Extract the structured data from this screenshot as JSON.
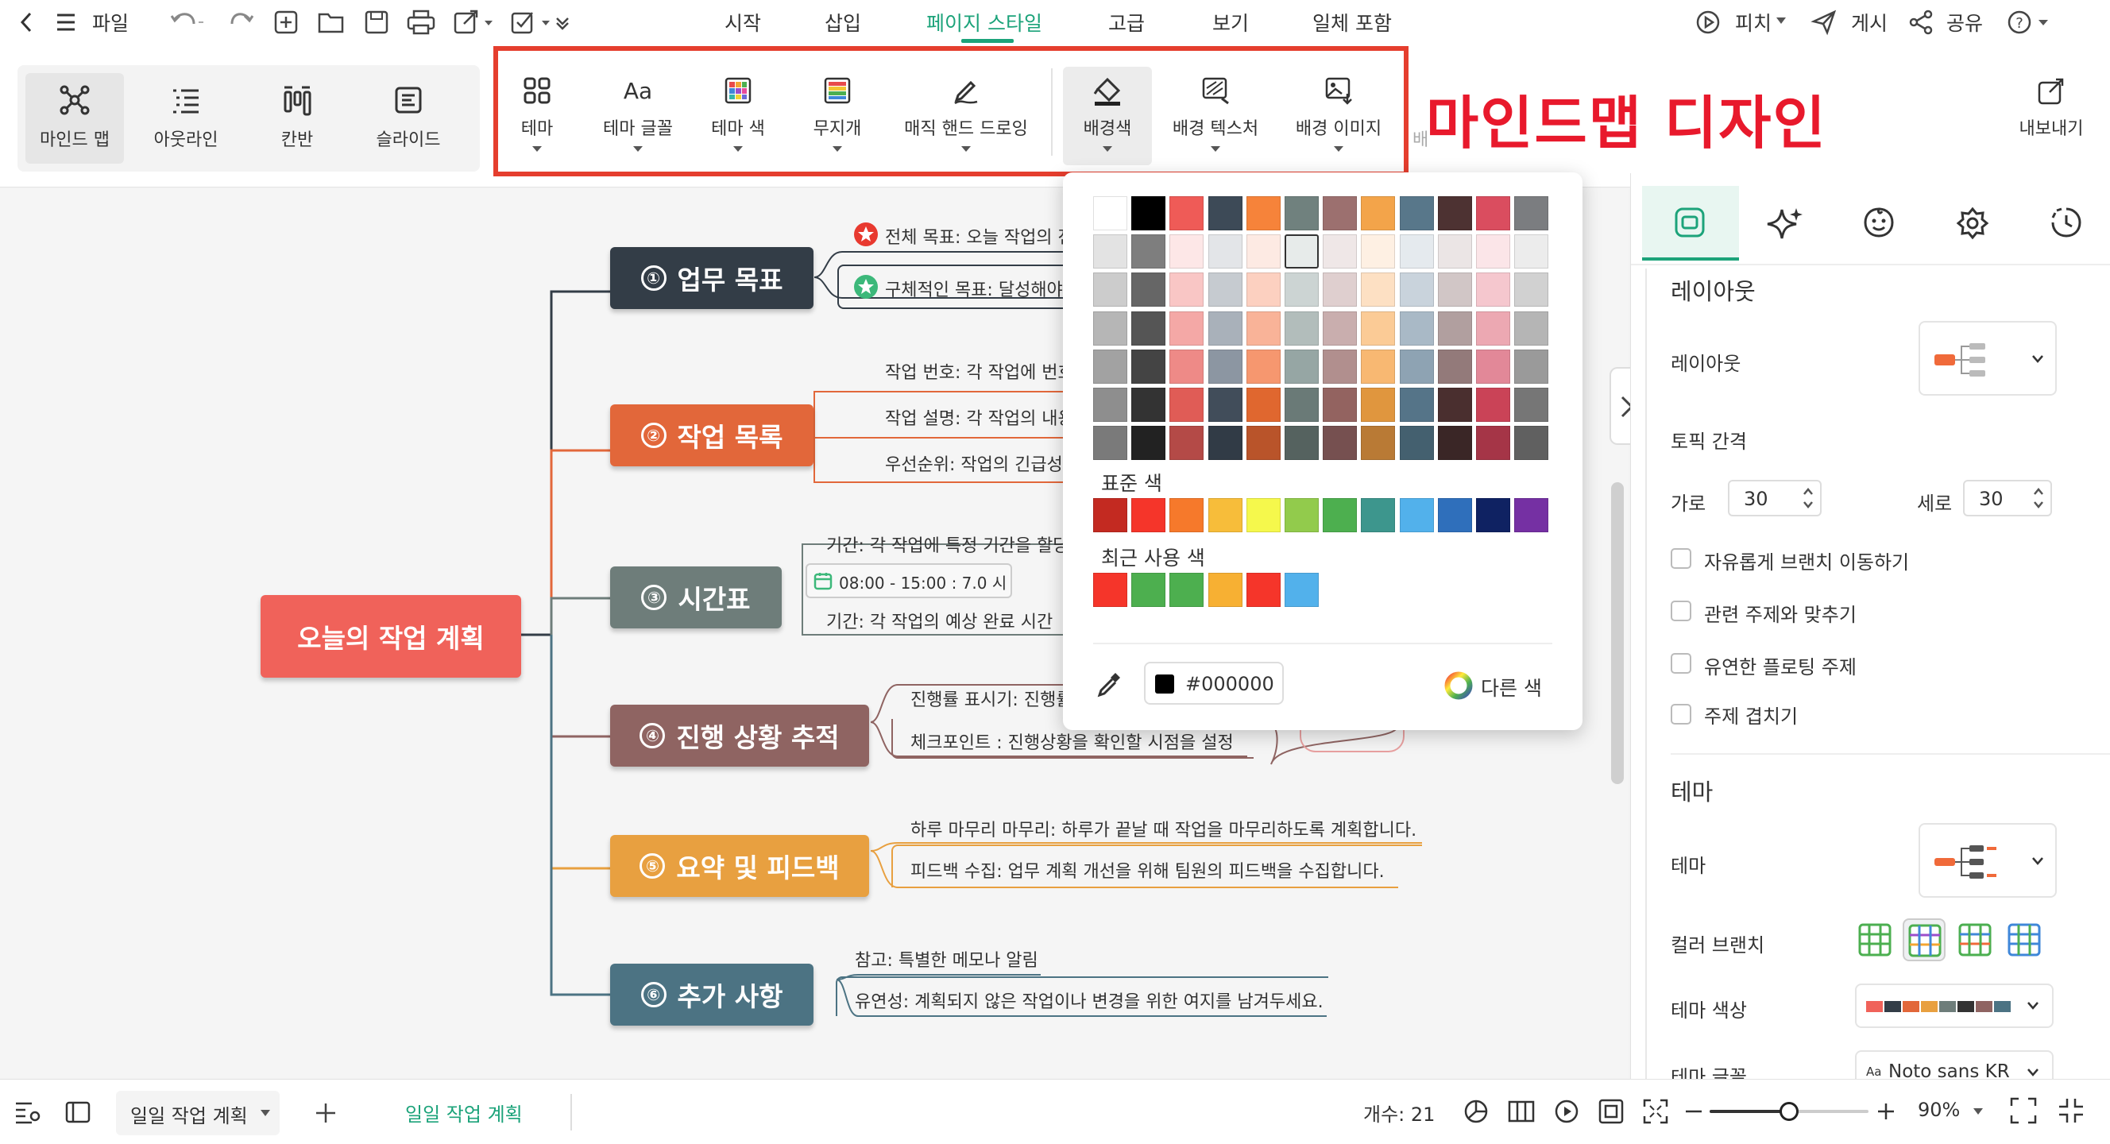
{
  "menubar": {
    "file_label": "파일",
    "tabs": [
      "시작",
      "삽입",
      "페이지 스타일",
      "고급",
      "보기",
      "일체 포함"
    ],
    "active_tab": "페이지 스타일",
    "right": {
      "pitch": "피치",
      "publish": "게시",
      "share": "공유"
    }
  },
  "views": [
    "마인드 맵",
    "아웃라인",
    "칸반",
    "슬라이드"
  ],
  "ribbon": {
    "buttons": [
      "테마",
      "테마 글꼴",
      "테마 색",
      "무지개",
      "매직 핸드 드로잉",
      "배경색",
      "배경 텍스처",
      "배경 이미지"
    ],
    "partial": "배",
    "export": "내보내기"
  },
  "annotation": "마인드맵 디자인",
  "mindmap": {
    "root": "오늘의 작업 계획",
    "topics": [
      {
        "num": "①",
        "label": "업무 목표",
        "color": "#333d47"
      },
      {
        "num": "②",
        "label": "작업 목록",
        "color": "#e2673a"
      },
      {
        "num": "③",
        "label": "시간표",
        "color": "#6e7d7a"
      },
      {
        "num": "④",
        "label": "진행 상황 추적",
        "color": "#8f6462"
      },
      {
        "num": "⑤",
        "label": "요약 및 피드백",
        "color": "#e8a040"
      },
      {
        "num": "⑥",
        "label": "추가 사항",
        "color": "#4c7383"
      }
    ],
    "root_color": "#f0625a",
    "subs": {
      "t1a": "전체 목표: 오늘 작업의 전",
      "t1b": "구체적인 목표: 달성해야",
      "t2a": "작업 번호: 각 작업에 번호",
      "t2b": "작업 설명: 각 작업의 내용",
      "t2c": "우선순위: 작업의 긴급성",
      "t3a": "기간: 각 작업에 특정 기간을 할당",
      "t3time": "08:00 - 15:00 : 7.0 시",
      "t3b": "기간: 각 작업의 예상 완료 시간",
      "t4a": "진행률 표시기: 진행률",
      "t4b": "체크포인트 : 진행상황을 확인할 시점을 설정",
      "t5a": "하루 마무리 마무리: 하루가 끝날 때 작업을 마무리하도록 계획합니다.",
      "t5b": "피드백 수집: 업무 계획 개선을 위해 팀원의 피드백을 수집합니다.",
      "t6a": "참고: 특별한 메모나 알림",
      "t6b": "유연성: 계획되지 않은 작업이나 변경을 위한 여지를 남겨두세요."
    }
  },
  "color_popup": {
    "palette": [
      [
        "#ffffff",
        "#000000",
        "#ef5b57",
        "#3d4a57",
        "#f6833a",
        "#70817e",
        "#9c706f",
        "#f3a44a",
        "#58778a",
        "#4d3232",
        "#da4d5f",
        "#7b7d80"
      ],
      [
        "#e3e3e3",
        "#7e7e7e",
        "#fde7e7",
        "#e3e5e8",
        "#fdeae3",
        "#e7ebea",
        "#efe7e7",
        "#fef0e3",
        "#e5eaee",
        "#ebe5e5",
        "#fbe5e8",
        "#ececec"
      ],
      [
        "#cccccc",
        "#666666",
        "#f9c6c5",
        "#c6cbd0",
        "#fcd0c0",
        "#ccd4d3",
        "#dfcfcf",
        "#fde0c3",
        "#c9d3dc",
        "#d1c6c6",
        "#f5c7ce",
        "#d1d1d1"
      ],
      [
        "#b6b6b6",
        "#555555",
        "#f4a8a6",
        "#a9b1ba",
        "#f9b398",
        "#b2bdbb",
        "#c9aeae",
        "#fbcb96",
        "#a9b9c6",
        "#b19f9f",
        "#eca8b2",
        "#b5b5b5"
      ],
      [
        "#a2a2a2",
        "#444444",
        "#ee8a87",
        "#8c96a2",
        "#f6976f",
        "#96a6a4",
        "#b18f8e",
        "#f8b872",
        "#8ea3b3",
        "#937a7a",
        "#e28898",
        "#9a9a9a"
      ],
      [
        "#8e8e8e",
        "#333333",
        "#e05c56",
        "#414d5a",
        "#e0672f",
        "#6a7a77",
        "#936360",
        "#e0963e",
        "#557488",
        "#4a2f2f",
        "#ca4357",
        "#767676"
      ],
      [
        "#7a7a7a",
        "#222222",
        "#b44a47",
        "#313b46",
        "#b9542a",
        "#55625f",
        "#765050",
        "#b97a35",
        "#44606f",
        "#3a2626",
        "#a53547",
        "#606060"
      ]
    ],
    "selected_swatch": "#e7ebea",
    "standard_label": "표준 색",
    "standard": [
      "#c32a21",
      "#f5352a",
      "#f6792b",
      "#f7bd3a",
      "#f5f84c",
      "#92cb4c",
      "#4daf4f",
      "#3d968d",
      "#52b1eb",
      "#2f6fbb",
      "#0f2262",
      "#7530a3"
    ],
    "recent_label": "최근 사용 색",
    "recent": [
      "#f5352a",
      "#4daf4f",
      "#4daf4f",
      "#f7b033",
      "#f5352a",
      "#52b1eb"
    ],
    "hex_value": "#000000",
    "hex_swatch": "#000000",
    "more_colors": "다른 색"
  },
  "panel": {
    "tabs": [
      "style-icon",
      "ai-icon",
      "emoji-icon",
      "badge-icon",
      "clock-icon"
    ],
    "layout_heading": "레이아웃",
    "layout_label": "레이아웃",
    "spacing_label": "토픽 간격",
    "horizontal_label": "가로",
    "horizontal_value": "30",
    "vertical_label": "세로",
    "vertical_value": "30",
    "checks": [
      "자유롭게 브랜치 이동하기",
      "관련 주제와 맞추기",
      "유연한 플로팅 주제",
      "주제 겹치기"
    ],
    "theme_heading": "테마",
    "theme_label": "테마",
    "branch_label": "컬러 브랜치",
    "theme_color_label": "테마 색상",
    "theme_font_label": "테마 글꼴",
    "font_name": "Noto sans KR",
    "theme_strip": [
      "#f0625a",
      "#333d47",
      "#e2673a",
      "#e8a040",
      "#6e7d7a",
      "#333",
      "#8f6462",
      "#4c7383"
    ]
  },
  "statusbar": {
    "tab_name": "일일 작업 계획",
    "center_tab": "일일 작업 계획",
    "count": "개수: 21",
    "zoom": "90%",
    "zoom_level": 0.5
  }
}
